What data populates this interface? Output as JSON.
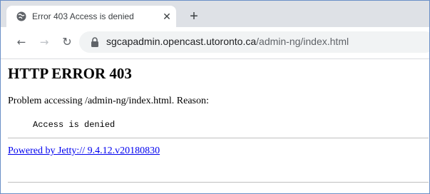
{
  "browser": {
    "tab": {
      "title": "Error 403 Access is denied",
      "favicon": "globe-icon",
      "close_icon": "close-icon"
    },
    "new_tab_icon": "plus-icon",
    "toolbar": {
      "back_icon": "arrow-left-icon",
      "forward_icon": "arrow-right-icon",
      "reload_icon": "reload-icon",
      "lock_icon": "lock-icon",
      "url_host": "sgcapadmin.opencast.utoronto.ca",
      "url_path": "/admin-ng/index.html"
    }
  },
  "page": {
    "heading": "HTTP ERROR 403",
    "problem_text": "Problem accessing /admin-ng/index.html. Reason:",
    "reason": "Access is denied",
    "powered_by": "Powered by Jetty:// 9.4.12.v20180830",
    "link_color": "#0000ee"
  }
}
